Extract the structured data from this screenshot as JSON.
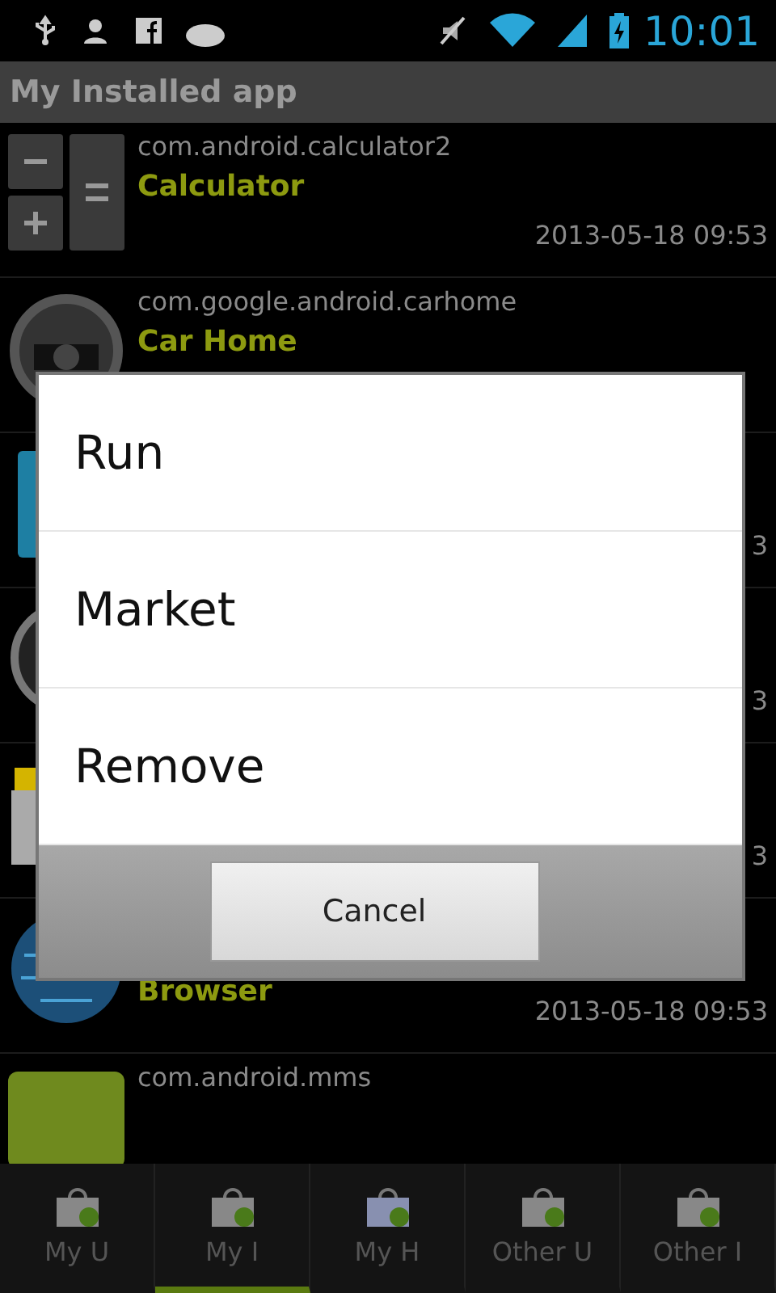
{
  "status_bar": {
    "time": "10:01"
  },
  "title": "My Installed app",
  "apps": [
    {
      "package": "com.android.calculator2",
      "name": "Calculator",
      "date": "2013-05-18 09:53"
    },
    {
      "package": "com.google.android.carhome",
      "name": "Car Home"
    },
    {
      "date": "3"
    },
    {
      "date": "3"
    },
    {
      "date": "3"
    },
    {
      "name": "Browser",
      "date": "2013-05-18 09:53"
    },
    {
      "package": "com.android.mms"
    }
  ],
  "dialog": {
    "items": [
      "Run",
      "Market",
      "Remove"
    ],
    "cancel": "Cancel"
  },
  "tabs": [
    {
      "label": "My U",
      "selected": false
    },
    {
      "label": "My I",
      "selected": true
    },
    {
      "label": "My H",
      "selected": false
    },
    {
      "label": "Other U",
      "selected": false
    },
    {
      "label": "Other I",
      "selected": false
    }
  ]
}
